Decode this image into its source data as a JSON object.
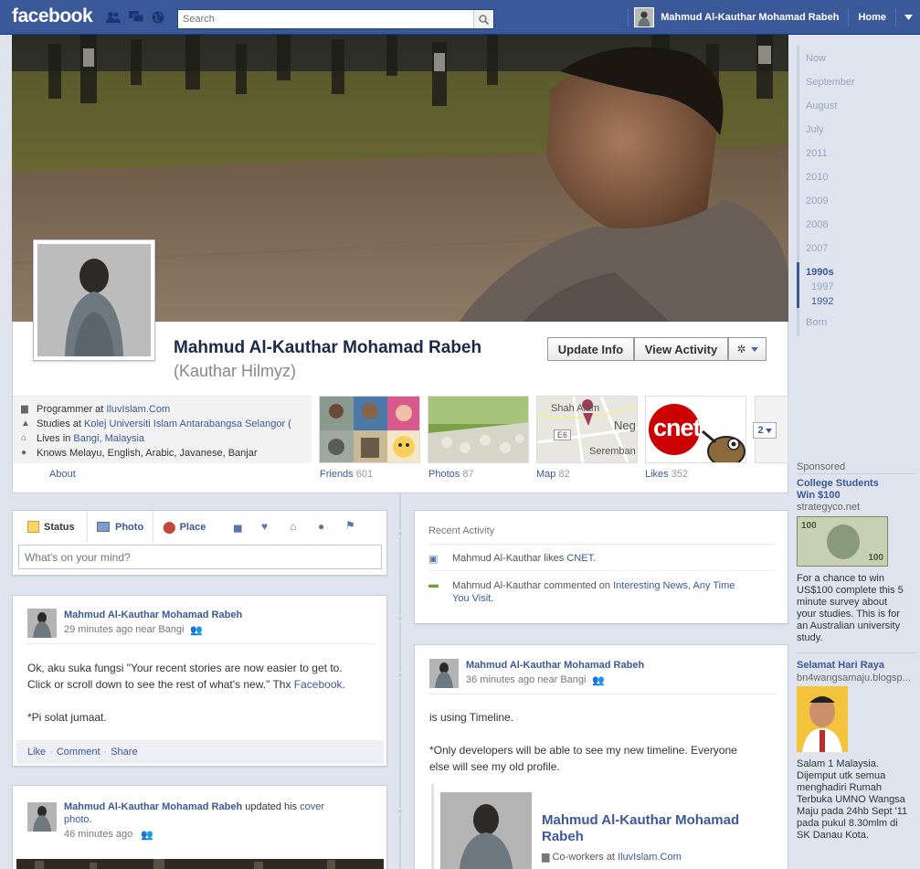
{
  "topbar": {
    "logo": "facebook",
    "search_placeholder": "Search",
    "user_name": "Mahmud Al-Kauthar Mohamad Rabeh",
    "home_label": "Home"
  },
  "profile": {
    "name": "Mahmud Al-Kauthar Mohamad Rabeh",
    "nickname": "(Kauthar Hilmyz)",
    "update_info": "Update Info",
    "view_activity": "View Activity"
  },
  "info": {
    "work_prefix": "Programmer at ",
    "work_link": "IluvIslam.Com",
    "study_prefix": "Studies at ",
    "study_link": "Kolej Universiti Islam Antarabangsa Selangor (",
    "lives_prefix": "Lives in ",
    "lives_link": "Bangi, Malaysia",
    "languages": "Knows Melayu, English, Arabic, Javanese, Banjar",
    "about": "About"
  },
  "tiles": {
    "friends": {
      "label": "Friends",
      "count": "601"
    },
    "photos": {
      "label": "Photos",
      "count": "87"
    },
    "map": {
      "label": "Map",
      "count": "82",
      "place1": "Shah Alam",
      "place2": "Neg",
      "place3": "Seremban",
      "road": "E6"
    },
    "likes": {
      "label": "Likes",
      "count": "352",
      "cnet": "cnet"
    },
    "more": "2"
  },
  "composer": {
    "status": "Status",
    "photo": "Photo",
    "place": "Place",
    "placeholder": "What's on your mind?"
  },
  "post1": {
    "name": "Mahmud Al-Kauthar Mohamad Rabeh",
    "meta": "29 minutes ago near Bangi",
    "line1": "Ok, aku suka fungsi \"Your recent stories are now easier to get to.",
    "line2_a": "Click or scroll down to see the rest of what's new.\" Thx ",
    "line2_link": "Facebook",
    "line2_b": ".",
    "line3": "*Pi solat jumaat.",
    "like": "Like",
    "comment": "Comment",
    "share": "Share"
  },
  "post2": {
    "name": "Mahmud Al-Kauthar Mohamad Rabeh",
    "action": " updated his ",
    "link": "cover",
    "link2": "photo",
    "dot": ".",
    "meta": "46 minutes ago"
  },
  "recent": {
    "title": "Recent Activity",
    "item1_a": "Mahmud Al-Kauthar likes ",
    "item1_link": "CNET",
    "item1_b": ".",
    "item2_a": "Mahmud Al-Kauthar commented on ",
    "item2_link1": "Interesting News, Any Time",
    "item2_link2": "You Visit",
    "item2_b": "."
  },
  "post3": {
    "name": "Mahmud Al-Kauthar Mohamad Rabeh",
    "meta": "36 minutes ago near Bangi",
    "line1": "is using Timeline.",
    "line2": "*Only developers will be able to see my new timeline. Everyone",
    "line3": "else will see my old profile.",
    "attach_name1": "Mahmud Al-Kauthar Mohamad",
    "attach_name2": "Rabeh",
    "attach_prefix": "Co-workers at ",
    "attach_link": "IluvIslam.Com"
  },
  "timeline_nav": [
    "Now",
    "September",
    "August",
    "July",
    "2011",
    "2010",
    "2009",
    "2008",
    "2007",
    "1990s",
    "1997",
    "1992",
    "Born"
  ],
  "sponsored": {
    "label": "Sponsored",
    "ad1": {
      "title1": "College Students",
      "title2": "Win $100",
      "url": "strategyco.net",
      "text": [
        "For a chance to win",
        "US$100 complete this 5",
        "minute survey about",
        "your studies. This is for",
        "an Australian university",
        "study."
      ]
    },
    "ad2": {
      "title": "Selamat Hari Raya",
      "url": "bn4wangsamaju.blogsp...",
      "text": [
        "Salam 1 Malaysia.",
        "Dijemput utk semua",
        "menghadiri Rumah",
        "Terbuka UMNO Wangsa",
        "Maju pada 24hb Sept '11",
        "pada pukul 8.30mlm di",
        "SK Danau Kota."
      ]
    },
    "bill_value": "100"
  },
  "colors": {
    "brand": "#3b5998",
    "page_bg": "#dfe3ee",
    "link": "#3b5998"
  }
}
